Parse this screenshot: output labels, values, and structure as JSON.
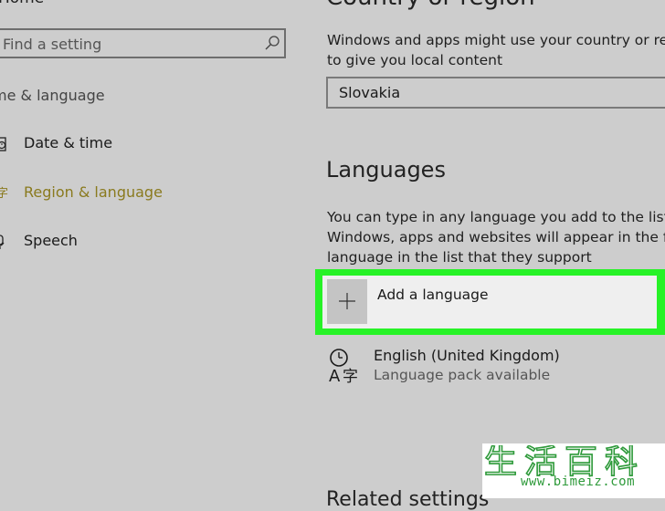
{
  "sidebar": {
    "home_label": "Home",
    "search": {
      "placeholder": "Find a setting"
    },
    "section_heading": "me & language",
    "items": [
      {
        "label": "Date & time",
        "icon": "clock-icon",
        "active": false
      },
      {
        "label": "Region & language",
        "icon": "language-icon",
        "active": true
      },
      {
        "label": "Speech",
        "icon": "microphone-icon",
        "active": false
      }
    ]
  },
  "main": {
    "country": {
      "heading": "Country or region",
      "description_line1": "Windows and apps might use your country or regi",
      "description_line2": "to give you local content",
      "selected": "Slovakia"
    },
    "languages": {
      "heading": "Languages",
      "description_line1": "You can type in any language you add to the list.",
      "description_line2": "Windows, apps and websites will appear in the first",
      "description_line3": "language in the list that they support",
      "add_button_label": "Add a language",
      "items": [
        {
          "name": "English (United Kingdom)",
          "status": "Language pack available",
          "icon": "language-clock-icon"
        }
      ]
    },
    "next_heading": "Related settings"
  },
  "watermark": {
    "chars": "生活百科",
    "url": "www.bimeiz.com"
  },
  "colors": {
    "background": "#cdcdcd",
    "accent_active": "#8a7a1e",
    "highlight": "#27f227",
    "watermark_green": "#2e9a3a"
  }
}
